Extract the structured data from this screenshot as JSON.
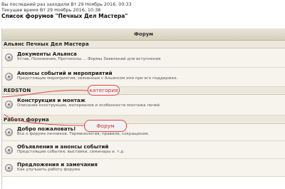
{
  "top": {
    "last_visit": "Вы последний раз заходили Вт 29 Ноябрь 2016, 00:33",
    "current_time": "Текущее время Вт 29 Ноябрь 2016, 10:38",
    "forum_list_title": "Список форумов \"Печных Дел Мастера\""
  },
  "table": {
    "header": "Форум"
  },
  "categories": [
    {
      "name": "Альянс Печных Дел Мастера",
      "forums": [
        {
          "name": "Документы Альянса",
          "desc": "Устав, Положения, Протоколы ... Формы Заявлений для вступления"
        },
        {
          "name": "Анонсы событий и мероприятий",
          "desc": "Предстоящие мероприятия, связанные с Альянсом или при его поддержке."
        }
      ]
    },
    {
      "name": "REDSTON",
      "forums": [
        {
          "name": "Конструкция и монтаж",
          "desc": "Описание конструкции, материалов и особенности монтажа печей."
        }
      ]
    },
    {
      "name": "Работа форума",
      "forums": [
        {
          "name": "Добро пожаловать!",
          "desc": "Все о форуме печников. Терминология, правила, сокращения."
        },
        {
          "name": "Объявления и анонсы событий",
          "desc": "Предстоящие события, выставки, семинары и. т.д"
        },
        {
          "name": "Предложения и замечания",
          "desc": "Как улучшить работу форума"
        }
      ]
    }
  ],
  "annotations": {
    "category_label": "категория",
    "forum_label": "Форум",
    "color": "#e04848"
  },
  "icons": {
    "forum": "forum-read-icon"
  }
}
